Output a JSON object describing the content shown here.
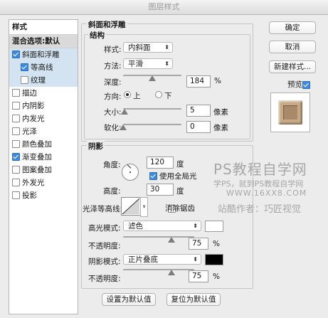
{
  "window": {
    "title": "图层样式"
  },
  "sidebar": {
    "header": "样式",
    "items": [
      {
        "label": "混合选项:默认",
        "checkbox": false,
        "checked": false,
        "selected": false,
        "sub": false,
        "blend": true
      },
      {
        "label": "斜面和浮雕",
        "checkbox": true,
        "checked": true,
        "selected": true,
        "sub": false
      },
      {
        "label": "等高线",
        "checkbox": true,
        "checked": true,
        "selected": true,
        "sub": true
      },
      {
        "label": "纹理",
        "checkbox": true,
        "checked": false,
        "selected": true,
        "sub": true
      },
      {
        "label": "描边",
        "checkbox": true,
        "checked": false,
        "selected": false,
        "sub": false
      },
      {
        "label": "内阴影",
        "checkbox": true,
        "checked": false,
        "selected": false,
        "sub": false
      },
      {
        "label": "内发光",
        "checkbox": true,
        "checked": false,
        "selected": false,
        "sub": false
      },
      {
        "label": "光泽",
        "checkbox": true,
        "checked": false,
        "selected": false,
        "sub": false
      },
      {
        "label": "颜色叠加",
        "checkbox": true,
        "checked": false,
        "selected": false,
        "sub": false
      },
      {
        "label": "渐变叠加",
        "checkbox": true,
        "checked": true,
        "selected": false,
        "sub": false
      },
      {
        "label": "图案叠加",
        "checkbox": true,
        "checked": false,
        "selected": false,
        "sub": false
      },
      {
        "label": "外发光",
        "checkbox": true,
        "checked": false,
        "selected": false,
        "sub": false
      },
      {
        "label": "投影",
        "checkbox": true,
        "checked": false,
        "selected": false,
        "sub": false
      }
    ]
  },
  "bevel": {
    "title": "斜面和浮雕",
    "structure_title": "结构",
    "style_label": "样式:",
    "style_value": "内斜面",
    "method_label": "方法:",
    "method_value": "平滑",
    "depth_label": "深度:",
    "depth_value": "184",
    "depth_unit": "%",
    "depth_level": 0.184,
    "direction_label": "方向:",
    "direction_up": "上",
    "direction_down": "下",
    "size_label": "大小:",
    "size_value": "5",
    "size_unit": "像素",
    "size_level": 0.02,
    "soften_label": "软化:",
    "soften_value": "0",
    "soften_unit": "像素",
    "soften_level": 0.0
  },
  "shading": {
    "title": "阴影",
    "angle_label": "角度:",
    "angle_value": "120",
    "angle_unit": "度",
    "global_light_label": "使用全局光",
    "global_light_checked": true,
    "altitude_label": "高度:",
    "altitude_value": "30",
    "altitude_unit": "度",
    "gloss_label": "光泽等高线:",
    "antialias_label": "消除锯齿",
    "antialias_checked": false,
    "highlight_label": "高光模式:",
    "highlight_value": "滤色",
    "highlight_color": "#ffffff",
    "highlight_opacity_label": "不透明度:",
    "highlight_opacity_value": "75",
    "highlight_opacity_unit": "%",
    "highlight_opacity_level": 0.75,
    "shadow_label": "阴影模式:",
    "shadow_value": "正片叠底",
    "shadow_color": "#000000",
    "shadow_opacity_label": "不透明度:",
    "shadow_opacity_value": "75",
    "shadow_opacity_unit": "%",
    "shadow_opacity_level": 0.75
  },
  "footer": {
    "set_default": "设置为默认值",
    "reset_default": "复位为默认值"
  },
  "actions": {
    "ok": "确定",
    "cancel": "取消",
    "new_style": "新建样式...",
    "preview_label": "预览",
    "preview_checked": true
  },
  "watermark": {
    "line1": "PS教程自学网",
    "line2": "学PS，就到PS教程自学网",
    "line3": "WWW.16XX8.COM",
    "line4": "站酷作者：巧匠视觉"
  },
  "colors": {
    "accent": "#3f8ae0",
    "preview_tile": "#c8aa86",
    "preview_inner": "#a88a6a"
  }
}
